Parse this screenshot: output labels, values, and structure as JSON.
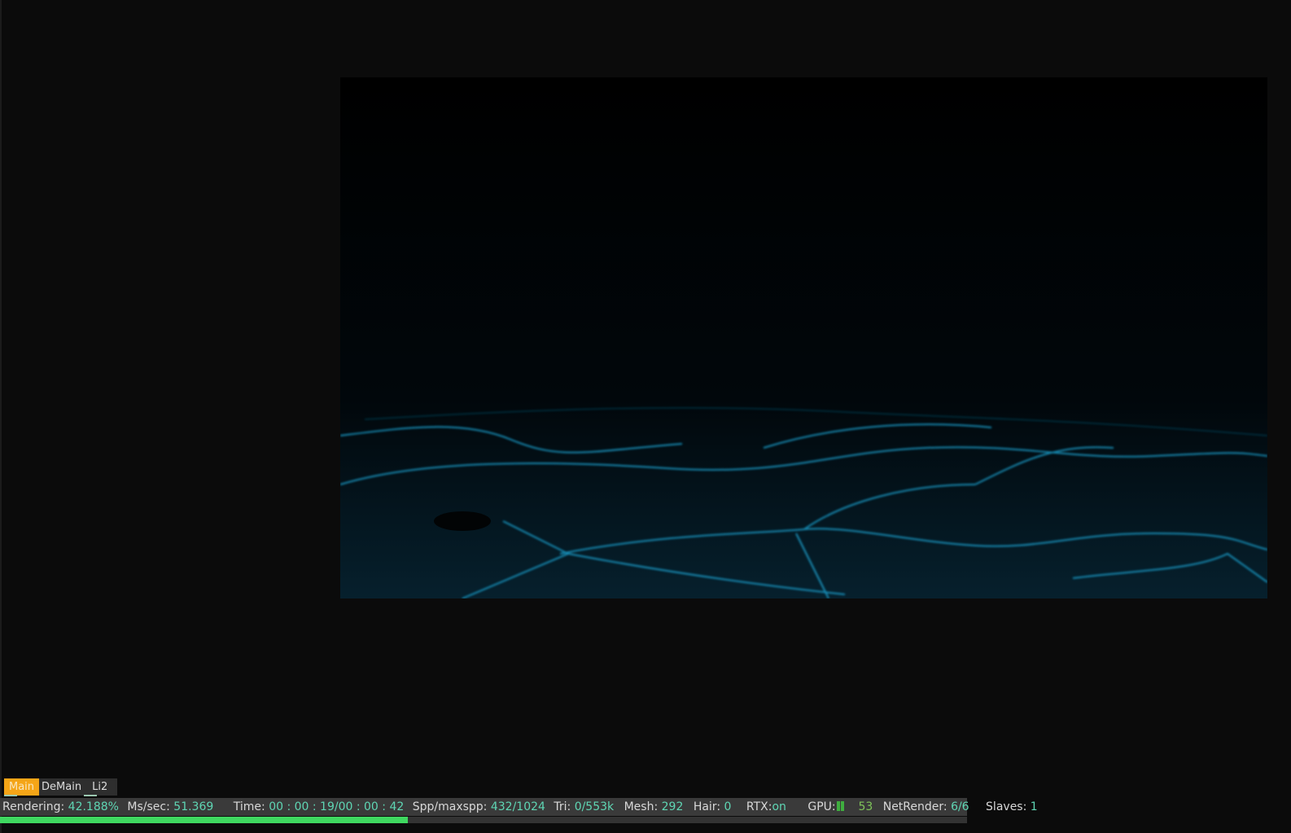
{
  "tabs": [
    {
      "label": "Main",
      "active": true
    },
    {
      "label": "DeMain",
      "active": false
    },
    {
      "label": "Li2",
      "active": false
    }
  ],
  "status": {
    "rendering_label": "Rendering:",
    "rendering_value": "42.188%",
    "mssec_label": "Ms/sec:",
    "mssec_value": "51.369",
    "time_label": "Time:",
    "time_value": "00 : 00 : 19/00 : 00 : 42",
    "spp_label": "Spp/maxspp:",
    "spp_value": "432/1024",
    "tri_label": "Tri:",
    "tri_value": "0/553k",
    "mesh_label": "Mesh:",
    "mesh_value": "292",
    "hair_label": "Hair:",
    "hair_value": "0",
    "rtx_label": "RTX:",
    "rtx_value": "on",
    "gpu_label": "GPU:",
    "gpu_value": "53",
    "netrender_label": "NetRender:",
    "netrender_value": "6/6",
    "slaves_label": "Slaves:",
    "slaves_value": "1"
  },
  "progress_percent": 42.188,
  "colors": {
    "accent_tab": "#f5a517",
    "value_text": "#5fd6b4",
    "progress": "#3fd860"
  }
}
